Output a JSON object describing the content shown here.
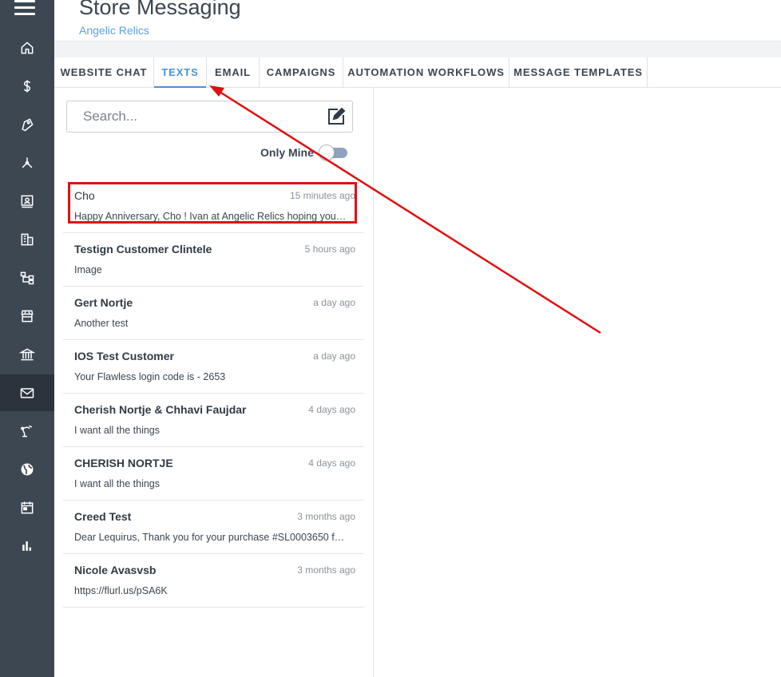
{
  "header": {
    "title": "Store Messaging",
    "subtitle": "Angelic Relics"
  },
  "nav": {
    "items": [
      {
        "icon": "home-icon"
      },
      {
        "icon": "dollar-icon"
      },
      {
        "icon": "tag-icon"
      },
      {
        "icon": "network-icon"
      },
      {
        "icon": "contact-card-icon"
      },
      {
        "icon": "building-icon"
      },
      {
        "icon": "hierarchy-icon"
      },
      {
        "icon": "storefront-icon"
      },
      {
        "icon": "bank-icon"
      },
      {
        "icon": "mail-icon"
      },
      {
        "icon": "robot-arm-icon"
      },
      {
        "icon": "globe-icon"
      },
      {
        "icon": "calendar-icon"
      },
      {
        "icon": "bar-chart-icon"
      }
    ],
    "active": "mail-icon"
  },
  "tabs": [
    {
      "label": "WEBSITE CHAT"
    },
    {
      "label": "TEXTS"
    },
    {
      "label": "EMAIL"
    },
    {
      "label": "CAMPAIGNS"
    },
    {
      "label": "AUTOMATION WORKFLOWS"
    },
    {
      "label": "MESSAGE TEMPLATES"
    }
  ],
  "active_tab": "TEXTS",
  "search": {
    "placeholder": "Search...",
    "value": ""
  },
  "filter": {
    "only_mine_label": "Only Mine",
    "only_mine_on": false
  },
  "conversations": [
    {
      "name": "Cho",
      "time": "15 minutes ago",
      "preview": "Happy Anniversary, Cho ! Ivan at Angelic Relics hoping you…"
    },
    {
      "name": "Testign Customer Clintele",
      "time": "5 hours ago",
      "preview": "Image"
    },
    {
      "name": "Gert Nortje",
      "time": "a day ago",
      "preview": "Another test"
    },
    {
      "name": "IOS Test Customer",
      "time": "a day ago",
      "preview": "Your Flawless login code is - 2653"
    },
    {
      "name": "Cherish Nortje & Chhavi Faujdar",
      "time": "4 days ago",
      "preview": "I want all the things"
    },
    {
      "name": "CHERISH NORTJE",
      "time": "4 days ago",
      "preview": "I want all the things"
    },
    {
      "name": "Creed Test",
      "time": "3 months ago",
      "preview": "Dear Lequirus, Thank you for your purchase #SL0003650 f…"
    },
    {
      "name": "Nicole Avasvsb",
      "time": "3 months ago",
      "preview": "https://flurl.us/pSA6K"
    }
  ],
  "colors": {
    "rail": "#3d4752",
    "accent": "#4a90d9",
    "annotation": "#e01010"
  }
}
